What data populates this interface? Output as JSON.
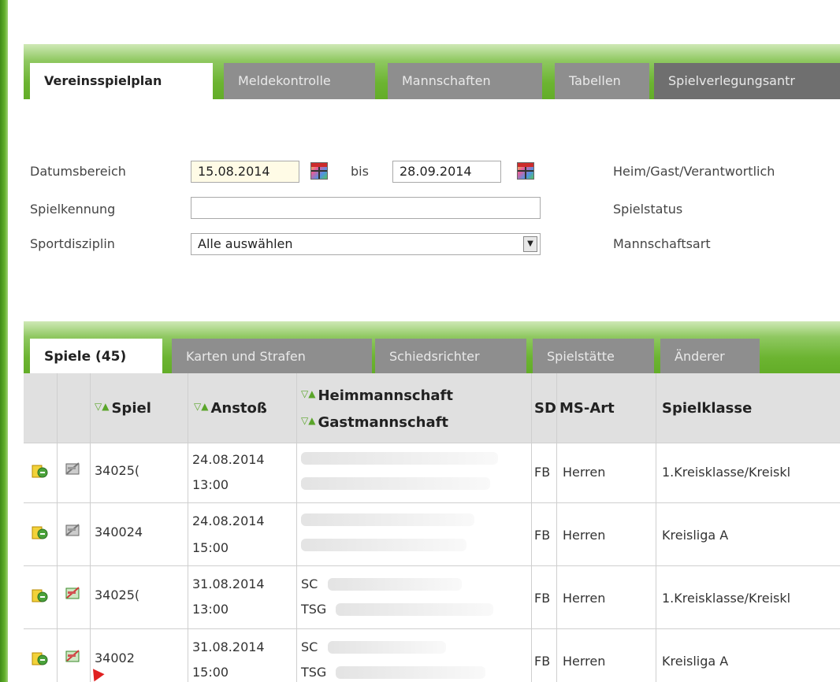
{
  "top_tabs": [
    "Vereinsspielplan",
    "Meldekontrolle",
    "Mannschaften",
    "Tabellen",
    "Spielverlegungsantr"
  ],
  "filter": {
    "date_label": "Datumsbereich",
    "date_from": "15.08.2014",
    "bis_label": "bis",
    "date_to": "28.09.2014",
    "spielkennung_label": "Spielkennung",
    "spielkennung_value": "",
    "sportdisziplin_label": "Sportdisziplin",
    "sportdisziplin_value": "Alle auswählen",
    "right_labels": [
      "Heim/Gast/Verantwortlich",
      "Spielstatus",
      "Mannschaftsart"
    ]
  },
  "sub_tabs": [
    "Spiele (45)",
    "Karten und Strafen",
    "Schiedsrichter",
    "Spielstätte",
    "Änderer"
  ],
  "table": {
    "sort_glyph": "▽▲",
    "headers": {
      "spiel": "Spiel",
      "anstoss": "Anstoß",
      "heim": "Heimmannschaft",
      "gast": "Gastmannschaft",
      "sd": "SD",
      "msart": "MS-Art",
      "spielklasse": "Spielklasse"
    },
    "rows": [
      {
        "spiel": "34025(",
        "date": "24.08.2014",
        "time": "13:00",
        "heim": "",
        "gast": "",
        "sd": "FB",
        "msart": "Herren",
        "klasse": "1.Kreisklasse/Kreiskl"
      },
      {
        "spiel": "340024",
        "date": "24.08.2014",
        "time": "15:00",
        "heim": "",
        "gast": "",
        "sd": "FB",
        "msart": "Herren",
        "klasse": "Kreisliga A"
      },
      {
        "spiel": "34025(",
        "date": "31.08.2014",
        "time": "13:00",
        "heim": "SC",
        "gast": "TSG",
        "sd": "FB",
        "msart": "Herren",
        "klasse": "1.Kreisklasse/Kreiskl"
      },
      {
        "spiel": "34002",
        "date": "31.08.2014",
        "time": "15:00",
        "heim": "SC",
        "gast": "TSG",
        "sd": "FB",
        "msart": "Herren",
        "klasse": "Kreisliga A"
      }
    ]
  }
}
